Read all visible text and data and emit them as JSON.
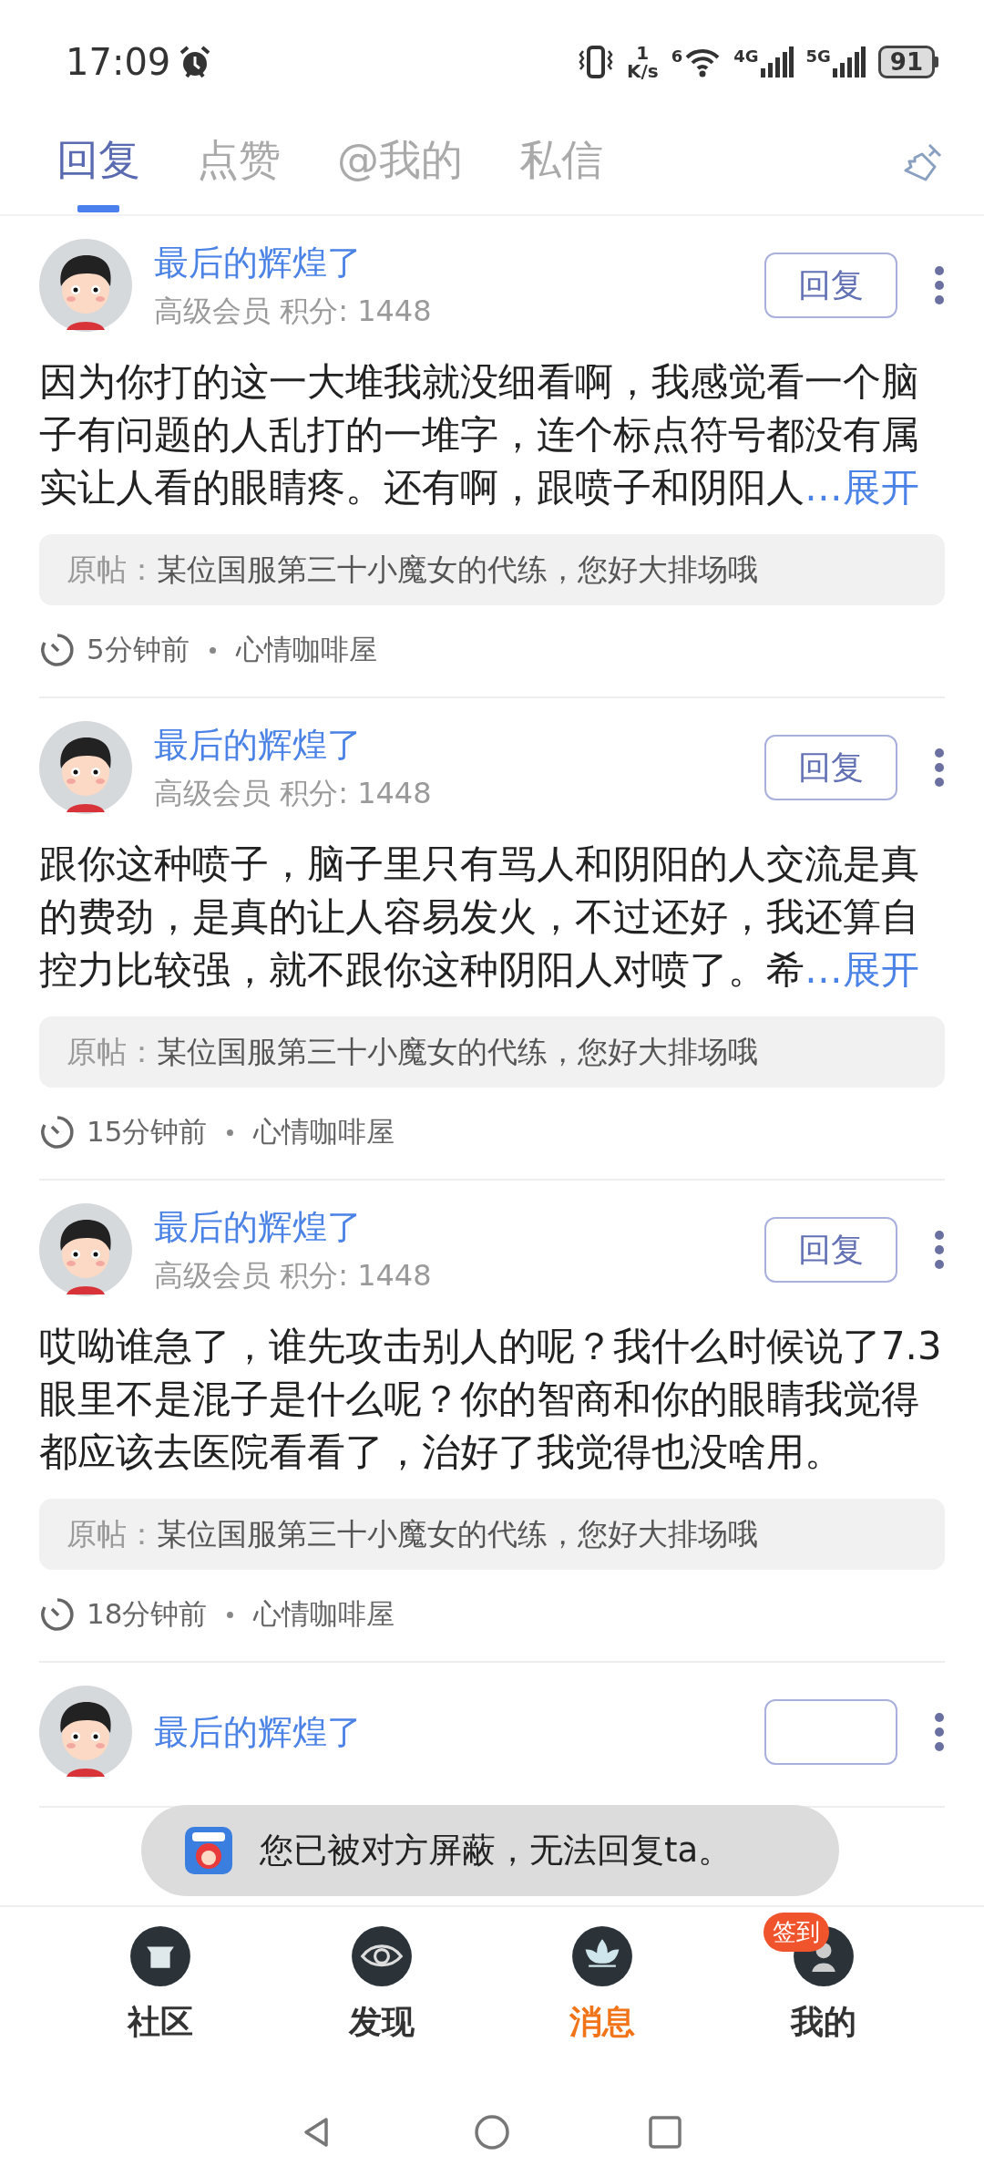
{
  "status_bar": {
    "time": "17:09",
    "net_speed": "1",
    "net_unit": "K/s",
    "wifi_label": "6",
    "sim1_label": "4G",
    "sim2_label": "5G",
    "battery": "91"
  },
  "tabs": [
    {
      "label": "回复",
      "selected": true
    },
    {
      "label": "点赞",
      "selected": false
    },
    {
      "label": "@我的",
      "selected": false
    },
    {
      "label": "私信",
      "selected": false
    }
  ],
  "replies": [
    {
      "name": "最后的辉煌了",
      "meta": "高级会员 积分: 1448",
      "reply_label": "回复",
      "body": "因为你打的这一大堆我就没细看啊，我感觉看一个脑子有问题的人乱打的一堆字，连个标点符号都没有属实让人看的眼睛疼。还有啊，跟喷子和阴阳人",
      "expand": "…展开",
      "quote_label": "原帖：",
      "quote": "某位国服第三十小魔女的代练，您好大排场哦",
      "time": "5分钟前",
      "board": "心情咖啡屋"
    },
    {
      "name": "最后的辉煌了",
      "meta": "高级会员 积分: 1448",
      "reply_label": "回复",
      "body": "跟你这种喷子，脑子里只有骂人和阴阳的人交流是真的费劲，是真的让人容易发火，不过还好，我还算自控力比较强，就不跟你这种阴阳人对喷了。希",
      "expand": "…展开",
      "quote_label": "原帖：",
      "quote": "某位国服第三十小魔女的代练，您好大排场哦",
      "time": "15分钟前",
      "board": "心情咖啡屋"
    },
    {
      "name": "最后的辉煌了",
      "meta": "高级会员 积分: 1448",
      "reply_label": "回复",
      "body": "哎呦谁急了，谁先攻击别人的呢？我什么时候说了7.3眼里不是混子是什么呢？你的智商和你的眼睛我觉得都应该去医院看看了，治好了我觉得也没啥用。",
      "quote_label": "原帖：",
      "quote": "某位国服第三十小魔女的代练，您好大排场哦",
      "time": "18分钟前",
      "board": "心情咖啡屋"
    },
    {
      "name": "最后的辉煌了"
    }
  ],
  "toast": {
    "text": "您已被对方屏蔽，无法回复ta。"
  },
  "bottom_nav": [
    {
      "label": "社区",
      "selected": false,
      "kind": "house"
    },
    {
      "label": "发现",
      "selected": false,
      "kind": "eye"
    },
    {
      "label": "消息",
      "selected": true,
      "kind": "lotus"
    },
    {
      "label": "我的",
      "selected": false,
      "kind": "figure",
      "badge": "签到"
    }
  ]
}
